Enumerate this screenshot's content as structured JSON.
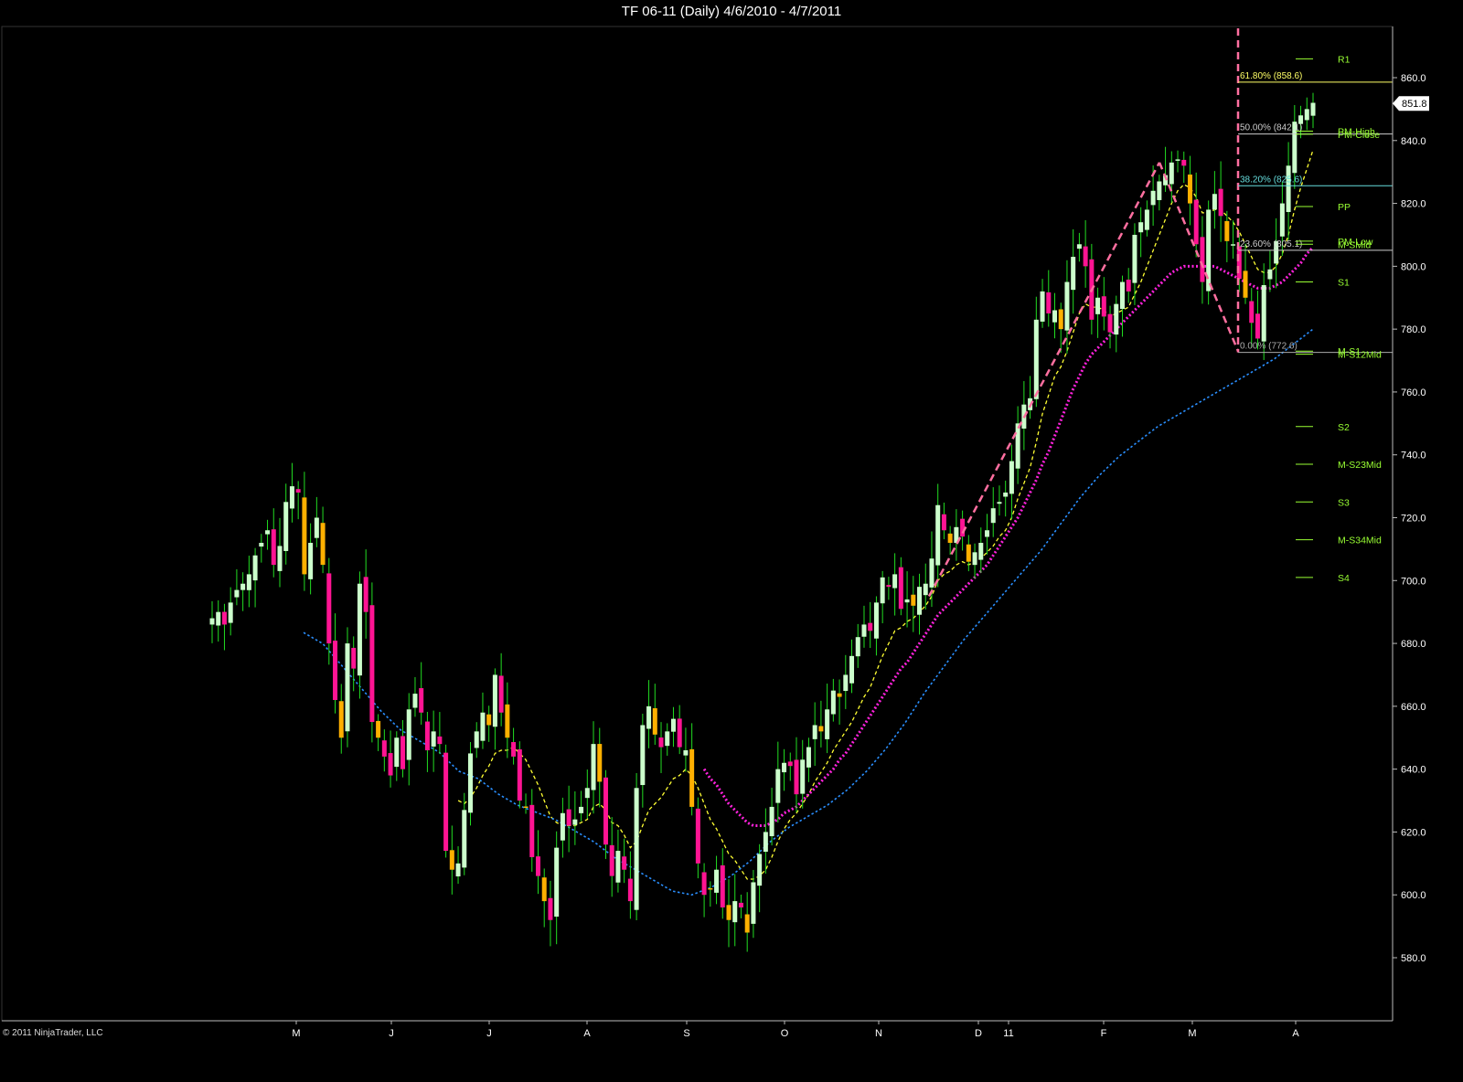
{
  "window": {
    "title": "TF 06-11 (Daily)  4/6/2010 - 4/7/2011"
  },
  "footer": {
    "copyright": "© 2011 NinjaTrader, LLC"
  },
  "chart_data": {
    "type": "candlestick",
    "instrument": "TF 06-11",
    "period": "Daily",
    "date_range": "4/6/2010 - 4/7/2011",
    "ylim": [
      570,
      865
    ],
    "y_ticks": [
      580,
      600,
      620,
      640,
      660,
      680,
      700,
      720,
      740,
      760,
      780,
      800,
      820,
      840,
      860
    ],
    "x_month_labels": [
      "M",
      "J",
      "J",
      "A",
      "S",
      "O",
      "N",
      "D",
      "11",
      "F",
      "M",
      "A"
    ],
    "last_price": "851.8",
    "grid": false,
    "colors": {
      "background": "#000000",
      "up_candle": "#ccffcc",
      "down_candle": "#ff1493",
      "down_candle_alt": "#ffb000",
      "wick": "#22dd22",
      "ma_fast": "#ffff33",
      "ma_mid": "#ff22dd",
      "ma_slow": "#2a8fff",
      "fib": "#ff6fa0",
      "pivot": "#99ff33"
    },
    "closes": [
      688,
      690,
      686,
      693,
      697,
      699,
      702,
      708,
      712,
      716,
      705,
      711,
      725,
      730,
      728,
      702,
      712,
      720,
      705,
      680,
      662,
      650,
      680,
      672,
      699,
      690,
      655,
      650,
      644,
      638,
      650,
      640,
      659,
      664,
      658,
      646,
      652,
      648,
      614,
      608,
      610,
      627,
      645,
      652,
      658,
      654,
      670,
      658,
      650,
      644,
      630,
      628,
      612,
      606,
      598,
      592,
      615,
      626,
      622,
      624,
      628,
      634,
      648,
      636,
      616,
      606,
      614,
      608,
      598,
      634,
      654,
      660,
      651,
      647,
      652,
      656,
      647,
      646,
      628,
      610,
      600,
      602,
      608,
      596,
      592,
      598,
      596,
      588,
      604,
      613,
      620,
      628,
      640,
      642,
      641,
      632,
      643,
      647,
      654,
      652,
      659,
      665,
      663,
      670,
      676,
      682,
      686,
      684,
      693,
      701,
      698,
      702,
      691,
      694,
      692,
      698,
      699,
      707,
      724,
      716,
      712,
      717,
      714,
      706,
      709,
      712,
      716,
      723,
      725,
      728,
      738,
      750,
      756,
      758,
      783,
      792,
      785,
      786,
      780,
      795,
      803,
      807,
      800,
      783,
      790,
      784,
      779,
      788,
      795,
      792,
      810,
      814,
      818,
      824,
      827,
      829,
      833,
      834,
      832,
      820,
      807,
      795,
      818,
      823,
      816,
      808,
      807,
      796,
      790,
      782,
      777,
      794,
      799,
      808,
      820,
      832,
      846,
      848,
      850,
      852
    ],
    "series": [
      {
        "name": "",
        "kind": "moving-average-fast",
        "values": [
          null,
          null,
          null,
          null,
          null,
          null,
          null,
          null,
          null,
          null,
          null,
          null,
          null,
          null,
          null,
          null,
          null,
          null,
          null,
          null,
          null,
          null,
          null,
          null,
          null,
          null,
          null,
          null,
          null,
          null,
          null,
          null,
          null,
          null,
          null,
          null,
          null,
          null,
          null,
          null,
          630,
          629,
          631,
          634,
          638,
          641,
          645,
          646,
          646,
          647,
          645,
          643,
          639,
          635,
          630,
          625,
          623,
          622,
          622,
          622,
          623,
          624,
          628,
          629,
          627,
          623,
          622,
          619,
          615,
          617,
          622,
          627,
          629,
          631,
          634,
          637,
          638,
          640,
          638,
          634,
          629,
          624,
          621,
          617,
          613,
          611,
          608,
          605,
          605,
          606,
          608,
          612,
          617,
          621,
          624,
          626,
          629,
          632,
          636,
          639,
          642,
          646,
          649,
          652,
          655,
          659,
          663,
          666,
          671,
          676,
          680,
          684,
          685,
          687,
          688,
          690,
          692,
          695,
          700,
          702,
          703,
          705,
          706,
          705,
          706,
          707,
          709,
          711,
          714,
          716,
          720,
          726,
          731,
          736,
          744,
          753,
          759,
          765,
          768,
          773,
          779,
          785,
          788,
          787,
          787,
          786,
          784,
          785,
          786,
          787,
          791,
          795,
          800,
          805,
          810,
          815,
          820,
          824,
          826,
          825,
          822,
          817,
          817,
          818,
          818,
          816,
          814,
          811,
          807,
          803,
          799,
          798,
          798,
          800,
          804,
          810,
          818,
          825,
          831,
          837
        ]
      },
      {
        "name": "",
        "kind": "moving-average-mid",
        "values": [
          null,
          null,
          null,
          null,
          null,
          null,
          null,
          null,
          null,
          null,
          null,
          null,
          null,
          null,
          null,
          null,
          null,
          null,
          null,
          null,
          null,
          null,
          null,
          null,
          null,
          null,
          null,
          null,
          null,
          null,
          null,
          null,
          null,
          null,
          null,
          null,
          null,
          null,
          null,
          null,
          null,
          null,
          null,
          null,
          null,
          null,
          null,
          null,
          null,
          null,
          null,
          null,
          null,
          null,
          null,
          null,
          null,
          null,
          null,
          null,
          null,
          null,
          null,
          null,
          null,
          null,
          null,
          null,
          null,
          null,
          null,
          null,
          null,
          null,
          null,
          null,
          null,
          null,
          null,
          null,
          640,
          637,
          635,
          632,
          629,
          627,
          625,
          623,
          622,
          622,
          622,
          623,
          624,
          626,
          627,
          628,
          630,
          632,
          634,
          636,
          638,
          640,
          643,
          645,
          648,
          651,
          654,
          657,
          660,
          663,
          666,
          669,
          672,
          674,
          677,
          680,
          683,
          686,
          689,
          691,
          693,
          695,
          697,
          699,
          701,
          703,
          705,
          708,
          711,
          714,
          717,
          720,
          724,
          728,
          732,
          737,
          741,
          746,
          751,
          756,
          761,
          765,
          769,
          772,
          774,
          776,
          778,
          780,
          782,
          784,
          786,
          788,
          790,
          792,
          794,
          796,
          798,
          799,
          800,
          800,
          800,
          800,
          800,
          800,
          799,
          798,
          797,
          796,
          795,
          794,
          793,
          793,
          793,
          794,
          795,
          797,
          799,
          801,
          804,
          806
        ]
      },
      {
        "name": "",
        "kind": "moving-average-slow",
        "values": [
          null,
          null,
          null,
          null,
          null,
          null,
          null,
          null,
          null,
          null,
          null,
          null,
          null,
          null,
          null,
          null,
          null,
          null,
          null,
          null,
          null,
          null,
          null,
          null,
          null,
          null,
          null,
          null,
          null,
          null,
          null,
          null,
          null,
          null,
          null,
          null,
          null,
          null,
          null,
          null,
          null,
          null,
          null,
          null,
          null,
          null,
          null,
          null,
          null,
          null,
          null,
          null,
          null,
          null,
          null,
          null,
          null,
          null,
          null,
          null,
          null,
          null,
          null,
          null,
          null,
          null,
          null,
          null,
          null,
          null,
          null,
          null,
          null,
          null,
          null,
          null,
          null,
          null,
          null,
          null,
          null,
          null,
          null,
          null,
          null,
          null,
          null,
          null,
          null,
          null,
          null,
          null,
          null,
          null,
          null,
          null,
          null,
          null,
          null,
          null,
          null,
          null,
          null,
          null,
          null,
          null,
          null,
          null,
          null,
          null,
          null,
          null,
          null,
          null,
          null,
          null,
          null,
          null,
          null,
          null,
          null,
          null,
          null,
          null,
          null,
          null,
          null,
          null,
          null,
          null,
          null,
          null,
          null,
          null,
          null,
          null,
          null,
          null,
          null,
          null,
          null,
          null,
          null,
          null,
          null,
          null,
          null,
          null,
          null,
          null,
          null,
          null,
          null,
          null,
          null,
          null,
          null,
          null,
          null,
          null,
          null,
          null,
          null,
          null,
          null,
          null,
          null,
          null,
          null,
          null,
          null,
          null,
          null,
          null,
          null,
          null,
          null,
          null,
          null,
          null
        ]
      }
    ],
    "ma_slow_points": [
      [
        700,
        701
      ],
      [
        720,
        698
      ],
      [
        740,
        692
      ],
      [
        760,
        686
      ],
      [
        780,
        680
      ],
      [
        800,
        675
      ],
      [
        820,
        672
      ],
      [
        840,
        669
      ],
      [
        860,
        664
      ],
      [
        880,
        662
      ],
      [
        900,
        658
      ],
      [
        920,
        655
      ],
      [
        940,
        653
      ],
      [
        960,
        651
      ],
      [
        980,
        648
      ],
      [
        1000,
        645
      ],
      [
        1020,
        641
      ],
      [
        1040,
        638
      ],
      [
        1060,
        635
      ],
      [
        1080,
        632
      ],
      [
        1100,
        631
      ],
      [
        1120,
        633
      ],
      [
        1140,
        636
      ],
      [
        1160,
        640
      ],
      [
        1180,
        645
      ],
      [
        1200,
        649
      ],
      [
        1220,
        652
      ],
      [
        1240,
        655
      ],
      [
        1260,
        659
      ],
      [
        1280,
        664
      ],
      [
        1300,
        670
      ],
      [
        1320,
        677
      ],
      [
        1340,
        685
      ],
      [
        1360,
        692
      ],
      [
        1380,
        699
      ],
      [
        1400,
        705
      ],
      [
        1420,
        711
      ],
      [
        1440,
        717
      ],
      [
        1460,
        723
      ],
      [
        1480,
        730
      ],
      [
        1500,
        737
      ],
      [
        1520,
        743
      ],
      [
        1540,
        748
      ],
      [
        1560,
        752
      ],
      [
        1580,
        756
      ],
      [
        1600,
        759
      ],
      [
        1620,
        762
      ],
      [
        1640,
        765
      ],
      [
        1660,
        768
      ],
      [
        1680,
        771
      ],
      [
        1700,
        774
      ],
      [
        1720,
        778
      ],
      [
        1740,
        782
      ]
    ],
    "fibonacci": {
      "levels": [
        {
          "label": "61.80% (858.6)",
          "value": 858.6,
          "color": "#ffff66"
        },
        {
          "label": "50.00% (842.1)",
          "value": 842.1,
          "color": "#cccccc"
        },
        {
          "label": "38.20% (825.6)",
          "value": 825.6,
          "color": "#66dddd"
        },
        {
          "label": "23.60% (805.1)",
          "value": 805.1,
          "color": "#cccccc"
        },
        {
          "label": "0.00% (772.6)",
          "value": 772.6,
          "color": "#aaaaaa"
        }
      ],
      "swing_lines": [
        {
          "from": [
            1016,
            695
          ],
          "to": [
            1268,
            833
          ]
        },
        {
          "from": [
            1268,
            833
          ],
          "to": [
            1354,
            773
          ]
        }
      ]
    },
    "pivots": [
      {
        "label": "R1",
        "value": 866
      },
      {
        "label": "PM-High",
        "value": 843
      },
      {
        "label": "PM-Close",
        "value": 842
      },
      {
        "label": "PP",
        "value": 819
      },
      {
        "label": "PM-Low",
        "value": 808
      },
      {
        "label": "M-SMid",
        "value": 807
      },
      {
        "label": "S1",
        "value": 795
      },
      {
        "label": "M-S1",
        "value": 773
      },
      {
        "label": "M-S12Mid",
        "value": 772
      },
      {
        "label": "S2",
        "value": 749
      },
      {
        "label": "M-S23Mid",
        "value": 737
      },
      {
        "label": "S3",
        "value": 725
      },
      {
        "label": "M-S34Mid",
        "value": 713
      },
      {
        "label": "S4",
        "value": 701
      }
    ]
  }
}
